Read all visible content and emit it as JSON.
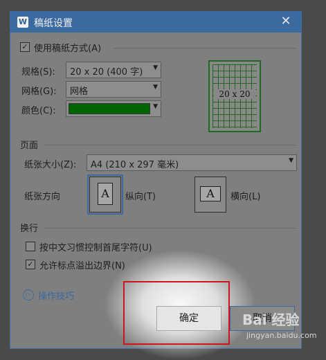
{
  "dialog": {
    "title": "稿纸设置",
    "app_icon": "W",
    "close_glyph": "✕",
    "use_paper_label": "使用稿纸方式(A)",
    "use_paper_checked": "✓",
    "spec_label": "规格(S):",
    "spec_value": "20 x 20 (400 字)",
    "grid_label": "网格(G):",
    "grid_value": "网格",
    "color_label": "颜色(C):",
    "color_value": "#006400",
    "preview_text": "20 x 20",
    "page_section": "页面",
    "paper_size_label": "纸张大小(Z):",
    "paper_size_value": "A4 (210 x 297 毫米)",
    "orientation_label": "纸张方向",
    "portrait_label": "纵向(T)",
    "landscape_label": "横向(L)",
    "orient_glyph": "A",
    "wrap_section": "换行",
    "option1_label": "按中文习惯控制首尾字符(U)",
    "option1_checked": "",
    "option2_label": "允许标点溢出边界(N)",
    "option2_checked": "✓",
    "tips_label": "操作技巧",
    "ok_label": "确定",
    "cancel_label": "取消",
    "dropdown_arrow": "▼"
  },
  "watermark": {
    "brand": "Bai 经验",
    "url": "jingyan.baidu.com"
  },
  "colors": {
    "title_bar": "#3a6aa0",
    "highlight": "#d0141a",
    "accent_green": "#1f6a1f"
  }
}
